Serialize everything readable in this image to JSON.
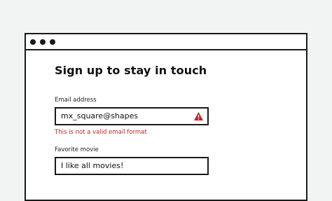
{
  "form": {
    "title": "Sign up to stay in touch",
    "email": {
      "label": "Email address",
      "value": "mx_square@shapes",
      "error": "This is not a valid email format",
      "status_icon": "warning-icon"
    },
    "movie": {
      "label": "Favorite movie",
      "value": "I like all movies!"
    }
  },
  "colors": {
    "error": "#c22424",
    "border": "#1a1a1a",
    "page_background": "#f1f4f3"
  }
}
